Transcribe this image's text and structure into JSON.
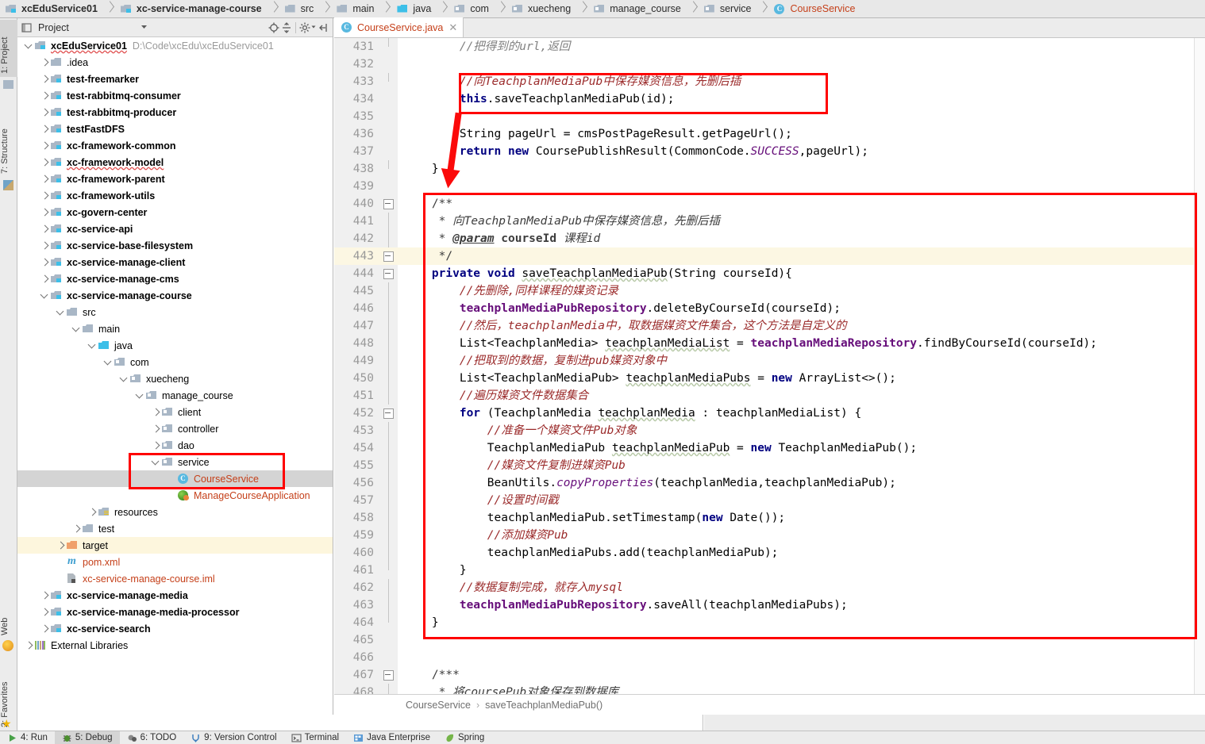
{
  "navbar": {
    "crumbs": [
      {
        "label": "xcEduService01",
        "icon": "module-icon",
        "bold": true
      },
      {
        "label": "xc-service-manage-course",
        "icon": "module-icon",
        "bold": true
      },
      {
        "label": "src",
        "icon": "folder-icon",
        "bold": false
      },
      {
        "label": "main",
        "icon": "folder-icon",
        "bold": false
      },
      {
        "label": "java",
        "icon": "source-folder-icon",
        "bold": false
      },
      {
        "label": "com",
        "icon": "package-icon",
        "bold": false
      },
      {
        "label": "xuecheng",
        "icon": "package-icon",
        "bold": false
      },
      {
        "label": "manage_course",
        "icon": "package-icon",
        "bold": false
      },
      {
        "label": "service",
        "icon": "package-icon",
        "bold": false
      },
      {
        "label": "CourseService",
        "icon": "class-icon",
        "bold": false,
        "accent": true
      }
    ]
  },
  "left_strip": {
    "tabs": [
      {
        "label": "1: Project",
        "selected": true,
        "icon": "project-icon"
      },
      {
        "label": "7: Structure",
        "selected": false,
        "icon": "structure-icon"
      }
    ],
    "bottom_tabs": [
      {
        "label": "Web",
        "icon": "web-icon"
      },
      {
        "label": "2: Favorites",
        "icon": "favorites-icon"
      }
    ]
  },
  "project_panel": {
    "title": "Project",
    "dropdown_icon": "chevron-down-icon",
    "toolbar_icons": [
      "locate-icon",
      "collapse-all-icon",
      "gear-icon",
      "hide-panel-icon"
    ],
    "tree": [
      {
        "depth": 0,
        "twisty": "down",
        "icon": "module-icon",
        "label": "xcEduService01",
        "bold": true,
        "wavy": true,
        "path": "D:\\Code\\xcEdu\\xcEduService01"
      },
      {
        "depth": 1,
        "twisty": "right",
        "icon": "folder-icon",
        "label": ".idea",
        "bold": false
      },
      {
        "depth": 1,
        "twisty": "right",
        "icon": "module-icon",
        "label": "test-freemarker",
        "bold": true
      },
      {
        "depth": 1,
        "twisty": "right",
        "icon": "module-icon",
        "label": "test-rabbitmq-consumer",
        "bold": true
      },
      {
        "depth": 1,
        "twisty": "right",
        "icon": "module-icon",
        "label": "test-rabbitmq-producer",
        "bold": true
      },
      {
        "depth": 1,
        "twisty": "right",
        "icon": "module-icon",
        "label": "testFastDFS",
        "bold": true
      },
      {
        "depth": 1,
        "twisty": "right",
        "icon": "module-icon",
        "label": "xc-framework-common",
        "bold": true
      },
      {
        "depth": 1,
        "twisty": "right",
        "icon": "module-icon",
        "label": "xc-framework-model",
        "bold": true,
        "wavy": true
      },
      {
        "depth": 1,
        "twisty": "right",
        "icon": "module-icon",
        "label": "xc-framework-parent",
        "bold": true
      },
      {
        "depth": 1,
        "twisty": "right",
        "icon": "module-icon",
        "label": "xc-framework-utils",
        "bold": true
      },
      {
        "depth": 1,
        "twisty": "right",
        "icon": "module-icon",
        "label": "xc-govern-center",
        "bold": true
      },
      {
        "depth": 1,
        "twisty": "right",
        "icon": "module-icon",
        "label": "xc-service-api",
        "bold": true
      },
      {
        "depth": 1,
        "twisty": "right",
        "icon": "module-icon",
        "label": "xc-service-base-filesystem",
        "bold": true
      },
      {
        "depth": 1,
        "twisty": "right",
        "icon": "module-icon",
        "label": "xc-service-manage-client",
        "bold": true
      },
      {
        "depth": 1,
        "twisty": "right",
        "icon": "module-icon",
        "label": "xc-service-manage-cms",
        "bold": true
      },
      {
        "depth": 1,
        "twisty": "down",
        "icon": "module-icon",
        "label": "xc-service-manage-course",
        "bold": true
      },
      {
        "depth": 2,
        "twisty": "down",
        "icon": "folder-icon",
        "label": "src",
        "bold": false
      },
      {
        "depth": 3,
        "twisty": "down",
        "icon": "folder-icon",
        "label": "main",
        "bold": false
      },
      {
        "depth": 4,
        "twisty": "down",
        "icon": "source-folder-icon",
        "label": "java",
        "bold": false
      },
      {
        "depth": 5,
        "twisty": "down",
        "icon": "package-icon",
        "label": "com",
        "bold": false
      },
      {
        "depth": 6,
        "twisty": "down",
        "icon": "package-icon",
        "label": "xuecheng",
        "bold": false
      },
      {
        "depth": 7,
        "twisty": "down",
        "icon": "package-icon",
        "label": "manage_course",
        "bold": false
      },
      {
        "depth": 8,
        "twisty": "right",
        "icon": "package-icon",
        "label": "client",
        "bold": false
      },
      {
        "depth": 8,
        "twisty": "right",
        "icon": "package-icon",
        "label": "controller",
        "bold": false
      },
      {
        "depth": 8,
        "twisty": "right",
        "icon": "package-icon",
        "label": "dao",
        "bold": false
      },
      {
        "depth": 8,
        "twisty": "down",
        "icon": "package-icon",
        "label": "service",
        "bold": false
      },
      {
        "depth": 9,
        "twisty": "none",
        "icon": "class-icon",
        "label": "CourseService",
        "bold": false,
        "orange": true,
        "selected": true
      },
      {
        "depth": 9,
        "twisty": "none",
        "icon": "spring-boot-icon",
        "label": "ManageCourseApplication",
        "bold": false,
        "orange": true
      },
      {
        "depth": 4,
        "twisty": "right",
        "icon": "resources-folder-icon",
        "label": "resources",
        "bold": false
      },
      {
        "depth": 3,
        "twisty": "right",
        "icon": "folder-icon",
        "label": "test",
        "bold": false
      },
      {
        "depth": 2,
        "twisty": "right",
        "icon": "target-folder-icon",
        "label": "target",
        "bold": false,
        "highlight": true
      },
      {
        "depth": 2,
        "twisty": "none",
        "icon": "maven-icon",
        "label": "pom.xml",
        "bold": false,
        "orange": true
      },
      {
        "depth": 2,
        "twisty": "none",
        "icon": "iml-icon",
        "label": "xc-service-manage-course.iml",
        "bold": false,
        "orange": true
      },
      {
        "depth": 1,
        "twisty": "right",
        "icon": "module-icon",
        "label": "xc-service-manage-media",
        "bold": true
      },
      {
        "depth": 1,
        "twisty": "right",
        "icon": "module-icon",
        "label": "xc-service-manage-media-processor",
        "bold": true
      },
      {
        "depth": 1,
        "twisty": "right",
        "icon": "module-icon",
        "label": "xc-service-search",
        "bold": true
      },
      {
        "depth": 0,
        "twisty": "right",
        "icon": "libraries-icon",
        "label": "External Libraries",
        "bold": false
      }
    ]
  },
  "editor": {
    "tabs": [
      {
        "label": "CourseService.java",
        "icon": "class-icon",
        "close_icon": "close-icon",
        "active": true
      }
    ],
    "first_line_number": 431,
    "current_line": 443,
    "breadcrumbs": [
      "CourseService",
      "saveTeachplanMediaPub()"
    ],
    "lines": [
      {
        "n": 431,
        "fold": "end",
        "html": "        <span class='cm'>//把得到的url,返回</span>"
      },
      {
        "n": 432,
        "fold": "none",
        "html": ""
      },
      {
        "n": 433,
        "fold": "end",
        "html": "        <span class='cmz'>//向TeachplanMediaPub中保存媒资信息，先删后插</span>"
      },
      {
        "n": 434,
        "fold": "none",
        "html": "        <span class='kw'>this</span>.saveTeachplanMediaPub(id);"
      },
      {
        "n": 435,
        "fold": "none",
        "html": ""
      },
      {
        "n": 436,
        "fold": "none",
        "html": "        String pageUrl = cmsPostPageResult.getPageUrl();"
      },
      {
        "n": 437,
        "fold": "none",
        "html": "        <span class='kw'>return</span> <span class='kw'>new</span> CoursePublishResult(CommonCode.<span class='stc'>SUCCESS</span>,pageUrl);"
      },
      {
        "n": 438,
        "fold": "end",
        "html": "    }"
      },
      {
        "n": 439,
        "fold": "none",
        "html": ""
      },
      {
        "n": 440,
        "fold": "minus",
        "html": "    <span class='doc'>/**</span>"
      },
      {
        "n": 441,
        "fold": "line",
        "html": "    <span class='doc'> * </span><span class='docz'>向TeachplanMediaPub中保存媒资信息，先删后插</span>"
      },
      {
        "n": 442,
        "fold": "line",
        "html": "    <span class='doc'> * </span><span class='tag'>@param</span> <span class='doc'><b>courseId</b></span> <span class='docz'>课程id</span>"
      },
      {
        "n": 443,
        "fold": "minus",
        "html": "    <span class='doc'> */</span>"
      },
      {
        "n": 444,
        "fold": "minus",
        "html": "    <span class='kw'>private</span> <span class='kw'>void</span> <span class='uline'>saveTeachplanMediaPub</span>(String courseId){"
      },
      {
        "n": 445,
        "fold": "line",
        "html": "        <span class='cmz'>//先删除,同样课程的媒资记录</span>"
      },
      {
        "n": 446,
        "fold": "line",
        "html": "        <span class='fld'>teachplanMediaPubRepository</span>.deleteByCourseId(courseId);"
      },
      {
        "n": 447,
        "fold": "line",
        "html": "        <span class='cmz'>//然后，teachplanMedia中，取数据媒资文件集合，这个方法是自定义的</span>"
      },
      {
        "n": 448,
        "fold": "line",
        "html": "        List&lt;TeachplanMedia&gt; <span class='uline'>teachplanMediaList</span> = <span class='fld'>teachplanMediaRepository</span>.findByCourseId(courseId);"
      },
      {
        "n": 449,
        "fold": "line",
        "html": "        <span class='cmz'>//把取到的数据，复制进pub媒资对象中</span>"
      },
      {
        "n": 450,
        "fold": "line",
        "html": "        List&lt;TeachplanMediaPub&gt; <span class='uline'>teachplanMediaPubs</span> = <span class='kw'>new</span> ArrayList&lt;&gt;();"
      },
      {
        "n": 451,
        "fold": "line",
        "html": "        <span class='cmz'>//遍历媒资文件数据集合</span>"
      },
      {
        "n": 452,
        "fold": "minus",
        "html": "        <span class='kw'>for</span> (TeachplanMedia <span class='uline'>teachplanMedia</span> : teachplanMediaList) {"
      },
      {
        "n": 453,
        "fold": "line",
        "html": "            <span class='cmz'>//准备一个媒资文件Pub对象</span>"
      },
      {
        "n": 454,
        "fold": "line",
        "html": "            TeachplanMediaPub <span class='uline'>teachplanMediaPub</span> = <span class='kw'>new</span> TeachplanMediaPub();"
      },
      {
        "n": 455,
        "fold": "line",
        "html": "            <span class='cmz'>//媒资文件复制进媒资Pub</span>"
      },
      {
        "n": 456,
        "fold": "line",
        "html": "            BeanUtils.<span class='stc'>copyProperties</span>(teachplanMedia,teachplanMediaPub);"
      },
      {
        "n": 457,
        "fold": "line",
        "html": "            <span class='cmz'>//设置时间戳</span>"
      },
      {
        "n": 458,
        "fold": "line",
        "html": "            teachplanMediaPub.setTimestamp(<span class='kw'>new</span> Date());"
      },
      {
        "n": 459,
        "fold": "line",
        "html": "            <span class='cmz'>//添加媒资Pub</span>"
      },
      {
        "n": 460,
        "fold": "line",
        "html": "            teachplanMediaPubs.add(teachplanMediaPub);"
      },
      {
        "n": 461,
        "fold": "end",
        "html": "        }"
      },
      {
        "n": 462,
        "fold": "line",
        "html": "        <span class='cmz'>//数据复制完成，就存入mysql</span>"
      },
      {
        "n": 463,
        "fold": "line",
        "html": "        <span class='fld'>teachplanMediaPubRepository</span>.saveAll(teachplanMediaPubs);"
      },
      {
        "n": 464,
        "fold": "end",
        "html": "    }"
      },
      {
        "n": 465,
        "fold": "none",
        "html": ""
      },
      {
        "n": 466,
        "fold": "none",
        "html": ""
      },
      {
        "n": 467,
        "fold": "minus",
        "html": "    <span class='doc'>/***</span>"
      },
      {
        "n": 468,
        "fold": "line",
        "html": "    <span class='doc'> * </span><span class='docz'>将coursePub对象保存到数据库</span>"
      }
    ]
  },
  "annotations": {
    "color": "#ff0000",
    "boxes": [
      {
        "name": "highlight-call-box"
      },
      {
        "name": "highlight-method-box"
      },
      {
        "name": "highlight-tree-service-box"
      }
    ],
    "arrow": {
      "name": "red-down-arrow"
    }
  },
  "bottom_bar": {
    "buttons": [
      {
        "label": "4: Run",
        "icon": "run-icon",
        "selected": false
      },
      {
        "label": "5: Debug",
        "icon": "debug-icon",
        "selected": true
      },
      {
        "label": "6: TODO",
        "icon": "todo-icon",
        "selected": false
      },
      {
        "label": "9: Version Control",
        "icon": "version-control-icon",
        "selected": false
      },
      {
        "label": "Terminal",
        "icon": "terminal-icon",
        "selected": false
      },
      {
        "label": "Java Enterprise",
        "icon": "java-enterprise-icon",
        "selected": false
      },
      {
        "label": "Spring",
        "icon": "spring-icon",
        "selected": false
      }
    ]
  }
}
